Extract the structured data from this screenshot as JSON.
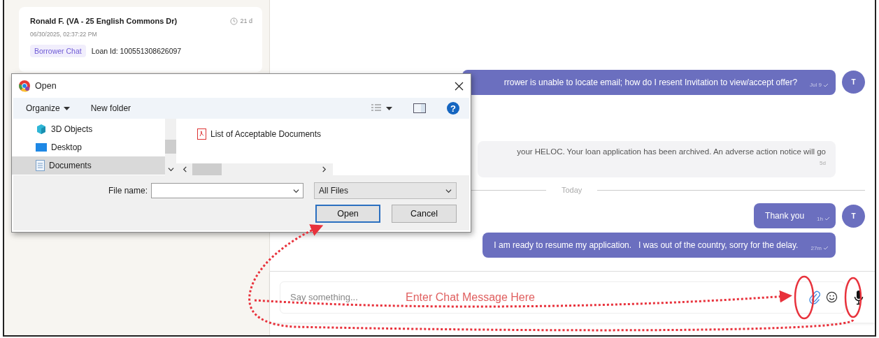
{
  "sidebar": {
    "card": {
      "name": "Ronald F. (VA - 25 English Commons Dr)",
      "age": "21 d",
      "date": "06/30/2025, 02:37:22 PM",
      "tag": "Borrower Chat",
      "loan_id": "Loan Id: 100551308626097"
    }
  },
  "chat": {
    "messages": [
      {
        "kind": "outgoing",
        "text": "rrower is unable to locate email; how do I resent Invitation to view/accept offer?",
        "time": "Jul 9",
        "avatar": "T"
      },
      {
        "kind": "incoming",
        "text": "your HELOC. Your loan application has been archived. An adverse action notice will go",
        "time": "5d"
      },
      {
        "kind": "divider",
        "text": "Today"
      },
      {
        "kind": "outgoing",
        "text": "Thank you",
        "time": "1h",
        "avatar": "T"
      },
      {
        "kind": "outgoing",
        "text": "I am ready to resume my application.   I was out of the country, sorry for the delay.",
        "time": "27m"
      }
    ],
    "composer": {
      "placeholder": "Say something..."
    }
  },
  "dialog": {
    "title": "Open",
    "toolbar": {
      "organize": "Organize",
      "new_folder": "New folder",
      "help": "?"
    },
    "nav_items": [
      {
        "label": "3D Objects",
        "kind": "objects",
        "selected": false
      },
      {
        "label": "Desktop",
        "kind": "desktop",
        "selected": false
      },
      {
        "label": "Documents",
        "kind": "documents",
        "selected": true
      }
    ],
    "files": [
      {
        "name": "List of Acceptable Documents"
      }
    ],
    "file_name_label": "File name:",
    "file_type": "All Files",
    "buttons": [
      {
        "label": "Open",
        "selected": true
      },
      {
        "label": "Cancel",
        "selected": false
      }
    ]
  },
  "annotation": {
    "label": "Enter Chat Message Here"
  }
}
